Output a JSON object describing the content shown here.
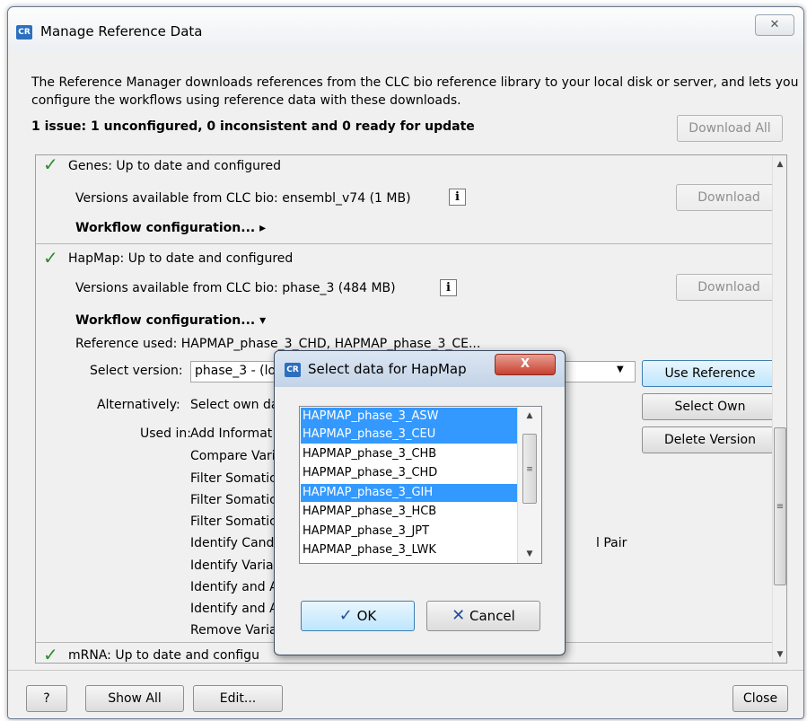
{
  "window": {
    "title": "Manage Reference Data",
    "app_icon": "CR",
    "close_glyph": "✕"
  },
  "description": "The Reference Manager downloads references from the CLC bio reference library to your local disk or server, and lets you configure the workflows using reference data with these downloads.",
  "issue_summary": "1 issue: 1 unconfigured, 0 inconsistent and 0 ready for update",
  "download_all_label": "Download All",
  "sections": {
    "genes": {
      "status": "Genes: Up to date and configured",
      "versions_text": "Versions available from CLC bio:  ensembl_v74 (1 MB)",
      "download_label": "Download",
      "workflow_config": "Workflow configuration... ▸"
    },
    "hapmap": {
      "status": "HapMap: Up to date and configured",
      "versions_text": "Versions available from CLC bio:  phase_3 (484 MB)",
      "download_label": "Download",
      "workflow_config": "Workflow configuration... ▾",
      "reference_used": "Reference used: HAPMAP_phase_3_CHD, HAPMAP_phase_3_CE...",
      "select_version_label": "Select version:",
      "select_version_value": "phase_3 - (lo",
      "alternatively_label": "Alternatively:",
      "alternatively_value": "Select own da",
      "used_in_label": "Used in:",
      "used_in_items": [
        "Add Informat",
        "Compare Vari",
        "Filter Somatic",
        "Filter Somatic",
        "Filter Somatic",
        "Identify Cand",
        "Identify Varia",
        "Identify and A",
        "Identify and A",
        "Remove Varia"
      ],
      "used_in_suffix": "l Pair",
      "use_reference_label": "Use Reference",
      "select_own_label": "Select Own",
      "delete_version_label": "Delete Version"
    },
    "mrna": {
      "status": "mRNA: Up to date and configu"
    }
  },
  "footer": {
    "help_label": "?",
    "show_all_label": "Show All",
    "edit_label": "Edit...",
    "close_label": "Close"
  },
  "dialog": {
    "title": "Select data for HapMap",
    "app_icon": "CR",
    "close_glyph": "X",
    "list_items": [
      {
        "label": "HAPMAP_phase_3_ASW",
        "selected": true
      },
      {
        "label": "HAPMAP_phase_3_CEU",
        "selected": true
      },
      {
        "label": "HAPMAP_phase_3_CHB",
        "selected": false
      },
      {
        "label": "HAPMAP_phase_3_CHD",
        "selected": false
      },
      {
        "label": "HAPMAP_phase_3_GIH",
        "selected": true
      },
      {
        "label": "HAPMAP_phase_3_HCB",
        "selected": false
      },
      {
        "label": "HAPMAP_phase_3_JPT",
        "selected": false
      },
      {
        "label": "HAPMAP_phase_3_LWK",
        "selected": false
      }
    ],
    "ok_label": "OK",
    "cancel_label": "Cancel"
  },
  "colors": {
    "check_green": "#2e8b2e",
    "selection_blue": "#3399ff",
    "default_button": "#bee6fd",
    "dialog_close_red": "#c7402f"
  }
}
